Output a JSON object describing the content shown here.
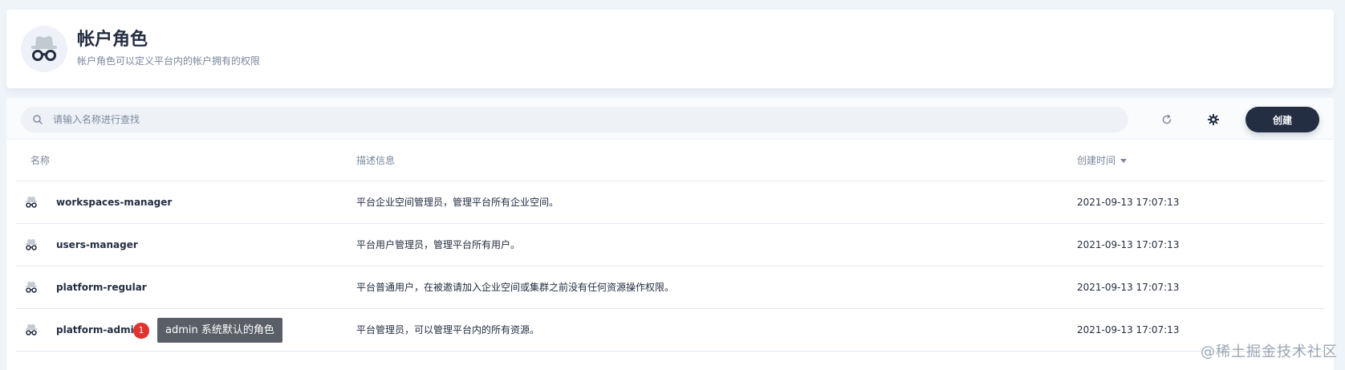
{
  "header": {
    "title": "帐户角色",
    "description": "帐户角色可以定义平台内的帐户拥有的权限",
    "icon": "incognito-icon"
  },
  "toolbar": {
    "search_placeholder": "请输入名称进行查找",
    "refresh_icon": "refresh-icon",
    "settings_icon": "gear-icon",
    "create_label": "创建"
  },
  "table": {
    "columns": {
      "name": "名称",
      "description": "描述信息",
      "created": "创建时间"
    },
    "rows": [
      {
        "name": "workspaces-manager",
        "description": "平台企业空间管理员，管理平台所有企业空间。",
        "created": "2021-09-13 17:07:13"
      },
      {
        "name": "users-manager",
        "description": "平台用户管理员，管理平台所有用户。",
        "created": "2021-09-13 17:07:13"
      },
      {
        "name": "platform-regular",
        "description": "平台普通用户，在被邀请加入企业空间或集群之前没有任何资源操作权限。",
        "created": "2021-09-13 17:07:13"
      },
      {
        "name": "platform-admin",
        "description": "平台管理员，可以管理平台内的所有资源。",
        "created": "2021-09-13 17:07:13"
      }
    ]
  },
  "annotation": {
    "badge": "1",
    "tooltip": "admin 系统默认的角色"
  },
  "watermark": "@稀土掘金技术社区",
  "colors": {
    "primary_dark": "#242e42",
    "muted_text": "#79879c",
    "page_bg": "#eff4f9",
    "badge_red": "#e0332f",
    "tooltip_bg": "#5a5e66"
  }
}
